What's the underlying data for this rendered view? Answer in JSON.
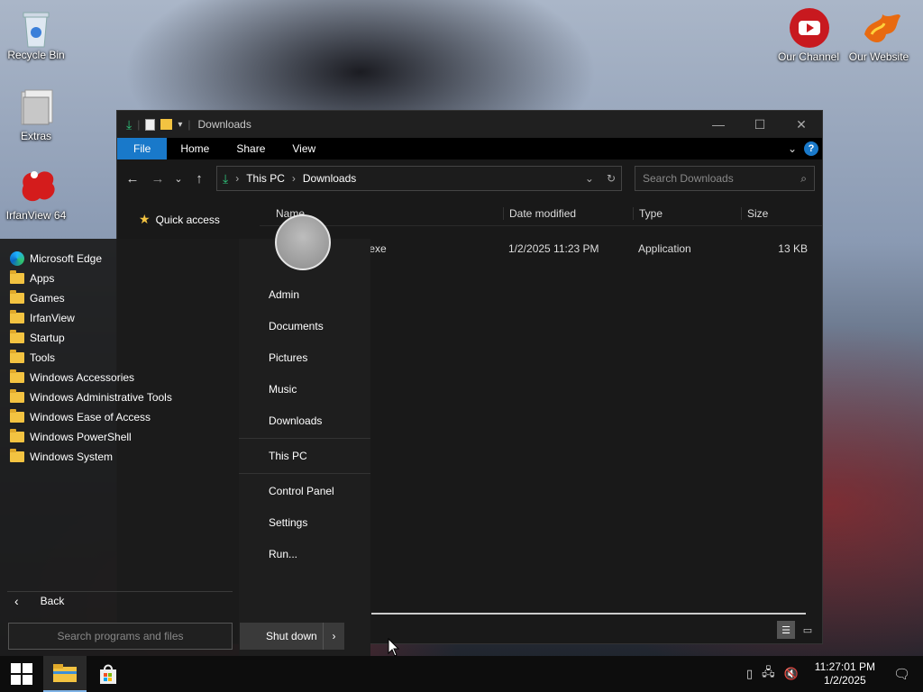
{
  "desktop": {
    "icons": [
      {
        "label": "Recycle Bin"
      },
      {
        "label": "Extras"
      },
      {
        "label": "IrfanView 64"
      },
      {
        "label": "Our Channel"
      },
      {
        "label": "Our Website"
      }
    ]
  },
  "explorer": {
    "title": "Downloads",
    "ribbon_tabs": [
      "File",
      "Home",
      "Share",
      "View"
    ],
    "address": {
      "crumbs": [
        "This PC",
        "Downloads"
      ]
    },
    "search_placeholder": "Search Downloads",
    "nav_pane": {
      "quick_access": "Quick access"
    },
    "columns": {
      "name": "Name",
      "date": "Date modified",
      "type": "Type",
      "size": "Size"
    },
    "files": [
      {
        "name": "er.exe",
        "date": "1/2/2025 11:23 PM",
        "type": "Application",
        "size": "13 KB"
      }
    ]
  },
  "start_menu": {
    "items": [
      {
        "label": "Microsoft Edge",
        "icon": "edge-icon"
      },
      {
        "label": "Apps",
        "icon": "folder-icon"
      },
      {
        "label": "Games",
        "icon": "folder-icon"
      },
      {
        "label": "IrfanView",
        "icon": "folder-icon"
      },
      {
        "label": "Startup",
        "icon": "folder-icon"
      },
      {
        "label": "Tools",
        "icon": "folder-icon"
      },
      {
        "label": "Windows Accessories",
        "icon": "folder-icon"
      },
      {
        "label": "Windows Administrative Tools",
        "icon": "folder-icon"
      },
      {
        "label": "Windows Ease of Access",
        "icon": "folder-icon"
      },
      {
        "label": "Windows PowerShell",
        "icon": "folder-icon"
      },
      {
        "label": "Windows System",
        "icon": "folder-icon"
      }
    ],
    "right": {
      "user": "Admin",
      "documents": "Documents",
      "pictures": "Pictures",
      "music": "Music",
      "downloads": "Downloads",
      "this_pc": "This PC",
      "control_panel": "Control Panel",
      "settings": "Settings",
      "run": "Run..."
    },
    "back_label": "Back",
    "search_placeholder": "Search programs and files",
    "shutdown_label": "Shut down"
  },
  "taskbar": {
    "time": "11:27:01 PM",
    "date": "1/2/2025"
  },
  "colors": {
    "accent": "#1979ca",
    "folder": "#f3c341"
  }
}
